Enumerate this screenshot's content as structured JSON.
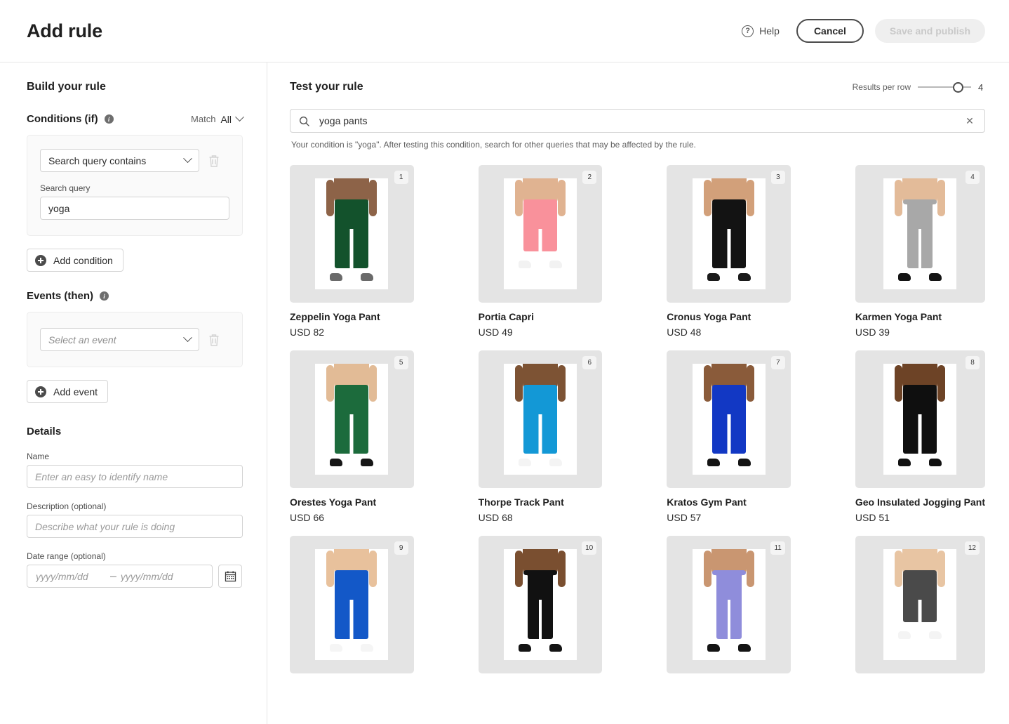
{
  "header": {
    "title": "Add rule",
    "help_label": "Help",
    "help_icon": "question-circle-icon",
    "cancel_label": "Cancel",
    "publish_label": "Save and publish"
  },
  "sidebar": {
    "title": "Build your rule",
    "conditions": {
      "heading": "Conditions (if)",
      "info_icon": "info-icon",
      "match_label": "Match",
      "match_value": "All",
      "chevron_icon": "chevron-down-icon",
      "condition_type": "Search query contains",
      "delete_icon": "trash-icon",
      "query_label": "Search query",
      "query_value": "yoga",
      "add_label": "Add condition",
      "add_icon": "plus-circle-icon"
    },
    "events": {
      "heading": "Events (then)",
      "info_icon": "info-icon",
      "select_placeholder": "Select an event",
      "delete_icon": "trash-icon",
      "add_label": "Add event",
      "add_icon": "plus-circle-icon"
    },
    "details": {
      "heading": "Details",
      "name_label": "Name",
      "name_placeholder": "Enter an easy to identify name",
      "name_value": "",
      "description_label": "Description (optional)",
      "description_placeholder": "Describe what your rule is doing",
      "description_value": "",
      "daterange_label": "Date range (optional)",
      "date_start_placeholder": "yyyy/mm/dd",
      "date_end_placeholder": "yyyy/mm/dd",
      "date_separator": "–",
      "calendar_icon": "calendar-icon"
    }
  },
  "content": {
    "title": "Test your rule",
    "results_per_row_label": "Results per row",
    "results_per_row_value": "4",
    "search_icon": "search-icon",
    "search_value": "yoga pants",
    "clear_icon": "close-icon",
    "hint": "Your condition is \"yoga\". After testing this condition, search for other queries that may be affected by the rule.",
    "products": [
      {
        "badge": "1",
        "name": "Zeppelin Yoga Pant",
        "price": "USD 82",
        "pants_color": "#13522c",
        "skin": "#8d6348",
        "shoe": "#6a6a6a",
        "style": "full"
      },
      {
        "badge": "2",
        "name": "Portia Capri",
        "price": "USD 49",
        "pants_color": "#f9919b",
        "skin": "#e0b391",
        "shoe": "#f2f2f2",
        "style": "capri"
      },
      {
        "badge": "3",
        "name": "Cronus Yoga Pant",
        "price": "USD 48",
        "pants_color": "#131313",
        "skin": "#d2a07a",
        "shoe": "#1a1a1a",
        "style": "full"
      },
      {
        "badge": "4",
        "name": "Karmen Yoga Pant",
        "price": "USD 39",
        "pants_color": "#a8a8a8",
        "skin": "#e3bb99",
        "shoe": "#141414",
        "style": "legging"
      },
      {
        "badge": "5",
        "name": "Orestes Yoga Pant",
        "price": "USD 66",
        "pants_color": "#1c6b3c",
        "skin": "#e2bb96",
        "shoe": "#161616",
        "style": "full"
      },
      {
        "badge": "6",
        "name": "Thorpe Track Pant",
        "price": "USD 68",
        "pants_color": "#1398d6",
        "skin": "#7d5334",
        "shoe": "#f4f4f4",
        "style": "full"
      },
      {
        "badge": "7",
        "name": "Kratos Gym Pant",
        "price": "USD 57",
        "pants_color": "#1238c4",
        "skin": "#8a5b3a",
        "shoe": "#141414",
        "style": "full"
      },
      {
        "badge": "8",
        "name": "Geo Insulated Jogging Pant",
        "price": "USD 51",
        "pants_color": "#0f0f0f",
        "skin": "#6d4326",
        "shoe": "#111111",
        "style": "full"
      },
      {
        "badge": "9",
        "name": "",
        "price": "",
        "pants_color": "#1358c8",
        "skin": "#e8c19c",
        "shoe": "#f5f5f5",
        "style": "full"
      },
      {
        "badge": "10",
        "name": "",
        "price": "",
        "pants_color": "#111111",
        "skin": "#7a4f30",
        "shoe": "#141414",
        "style": "legging"
      },
      {
        "badge": "11",
        "name": "",
        "price": "",
        "pants_color": "#8f8ddb",
        "skin": "#c99671",
        "shoe": "#141414",
        "style": "legging"
      },
      {
        "badge": "12",
        "name": "",
        "price": "",
        "pants_color": "#4a4a4a",
        "skin": "#e8c5a3",
        "shoe": "#f4f4f4",
        "style": "capri"
      }
    ]
  },
  "colors": {
    "card_bg": "#e4e4e4",
    "panel_bg": "#fafafa",
    "border": "#e6e6e6",
    "text": "#2c2c2c"
  }
}
